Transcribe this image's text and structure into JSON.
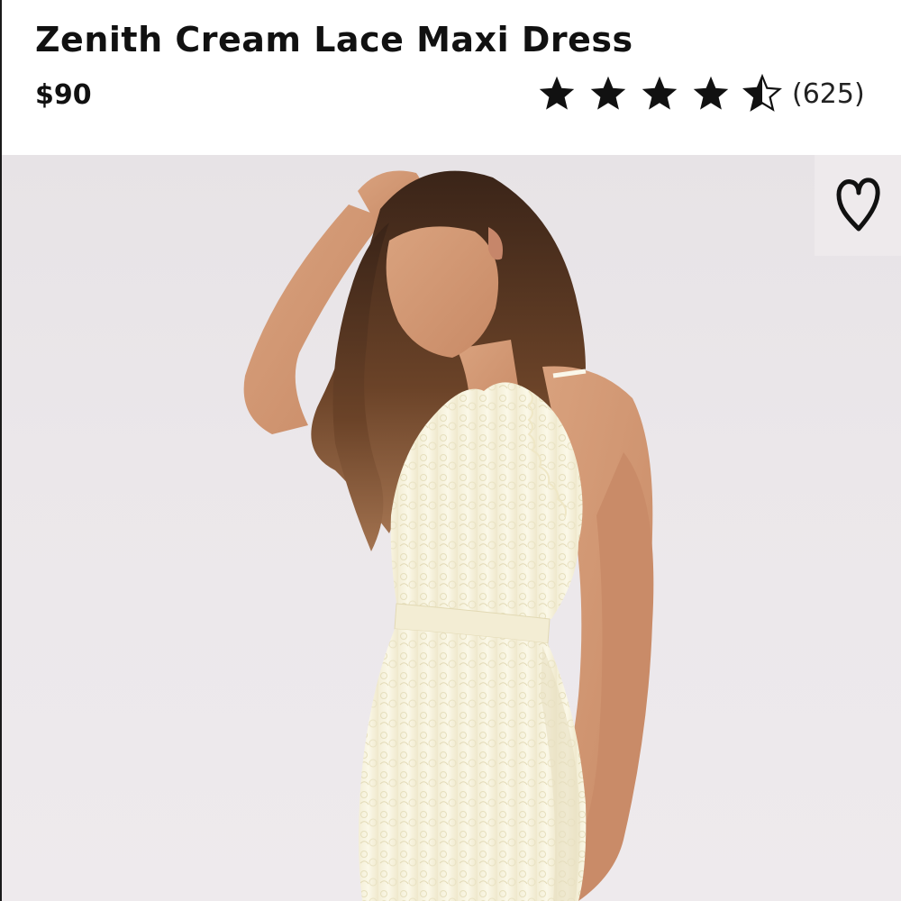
{
  "product": {
    "title": "Zenith Cream Lace Maxi Dress",
    "price": "$90",
    "rating": {
      "value": 4.5,
      "max": 5,
      "count_label": "(625)"
    }
  },
  "icons": {
    "star": "star-icon",
    "wishlist": "heart-icon"
  },
  "colors": {
    "text": "#111111",
    "background": "#ffffff",
    "photo_background": "#ebe7ea",
    "dress": "#f7f3df"
  }
}
